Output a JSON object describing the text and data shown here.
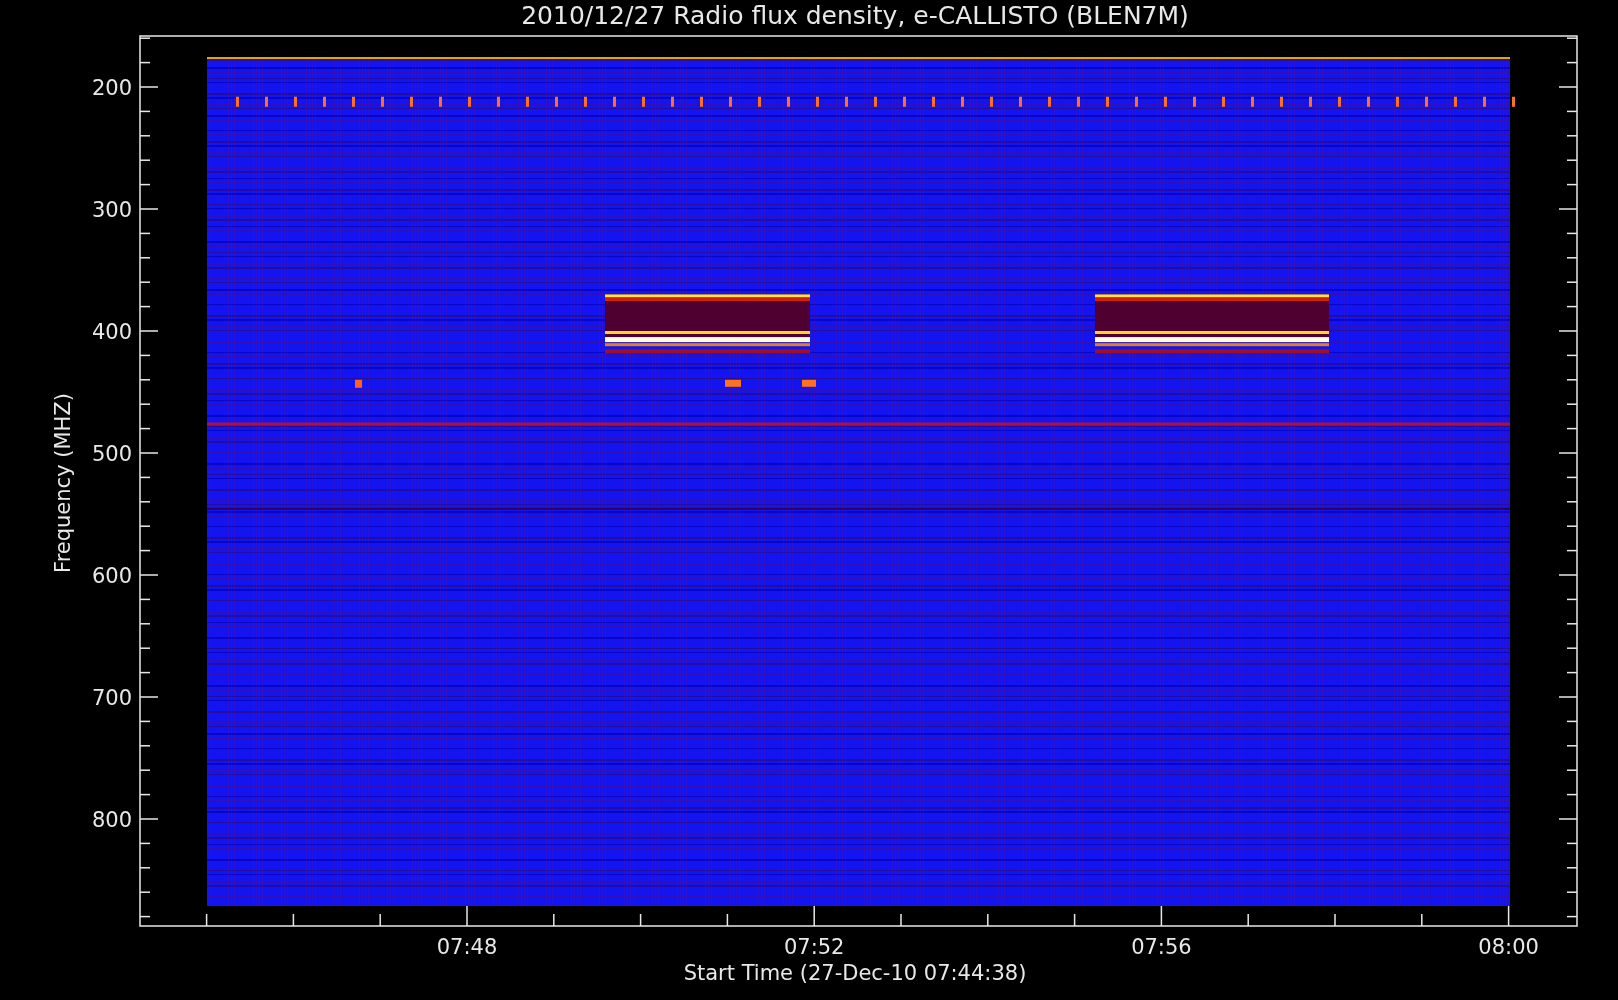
{
  "plot": {
    "title": "2010/12/27  Radio flux density, e-CALLISTO (BLEN7M)",
    "ylabel": "Frequency (MHZ)",
    "xlabel": "Start Time (27-Dec-10 07:44:38)",
    "yticks": [
      "200",
      "300",
      "400",
      "500",
      "600",
      "700",
      "800"
    ],
    "xticks": [
      "07:48",
      "07:52",
      "07:56",
      "08:00"
    ]
  }
}
